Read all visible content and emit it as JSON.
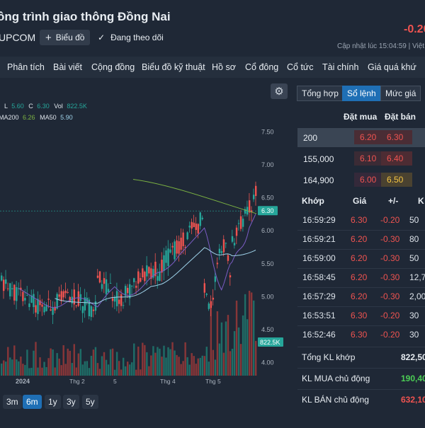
{
  "header": {
    "title": "ông trình giao thông Đồng Nai",
    "exchange": "UPCOM",
    "chart_button": "Biểu đồ",
    "follow_label": "Đang theo dõi",
    "change": "-0.20",
    "updated": "Cập nhật lúc  15:04:59 | Việt"
  },
  "nav": [
    "Phân tích",
    "Bài viết",
    "Cộng đồng",
    "Biểu đồ kỹ thuật",
    "Hồ sơ",
    "Cổ đông",
    "Cổ tức",
    "Tài chính",
    "Giá quá khứ"
  ],
  "legend": {
    "ohlc": [
      {
        "label": "L",
        "value": "5.60"
      },
      {
        "label": "C",
        "value": "6.30"
      },
      {
        "label": "Vol",
        "value": "822.5K"
      }
    ],
    "ma": [
      {
        "label": "MA200",
        "value": "6.26"
      },
      {
        "label": "MA50",
        "value": "5.90"
      }
    ]
  },
  "colors": {
    "up": "#26a69a",
    "down": "#ef5350",
    "ma200": "#7cb342",
    "ma50": "#9fd3ea",
    "ma20": "#7b5cc4",
    "accent": "#1f6fb5"
  },
  "chart_data": {
    "type": "candlestick",
    "y_ticks": [
      "7.50",
      "7.00",
      "6.50",
      "6.00",
      "5.50",
      "5.00",
      "4.50",
      "4.00"
    ],
    "ylim": [
      3.9,
      7.6
    ],
    "x_ticks": [
      "2024",
      "Thg 2",
      "5",
      "Thg 4",
      "Thg 5"
    ],
    "last_price_label": "6.30",
    "last_volume_label": "822.5K",
    "last_price": 6.3
  },
  "range_buttons": [
    "3m",
    "6m",
    "1y",
    "3y",
    "5y"
  ],
  "range_active": "6m",
  "right_panel": {
    "tabs": [
      "Tổng hợp",
      "Sổ lệnh",
      "Mức giá"
    ],
    "active_tab": "Sổ lệnh",
    "orderbook_headers": {
      "bid": "Đặt mua",
      "ask": "Đặt bán"
    },
    "orderbook": [
      {
        "vol": "200",
        "bid": "6.20",
        "ask": "6.30"
      },
      {
        "vol": "155,000",
        "bid": "6.10",
        "ask": "6.40"
      },
      {
        "vol": "164,900",
        "bid": "6.00",
        "ask": "6.50"
      }
    ],
    "trades_headers": {
      "time": "Khớp",
      "price": "Giá",
      "change": "+/-",
      "vol": "K"
    },
    "trades": [
      {
        "time": "16:59:29",
        "price": "6.30",
        "change": "-0.20",
        "vol": "50"
      },
      {
        "time": "16:59:21",
        "price": "6.20",
        "change": "-0.30",
        "vol": "80"
      },
      {
        "time": "16:59:00",
        "price": "6.20",
        "change": "-0.30",
        "vol": "50"
      },
      {
        "time": "16:58:45",
        "price": "6.20",
        "change": "-0.30",
        "vol": "12,70"
      },
      {
        "time": "16:57:29",
        "price": "6.20",
        "change": "-0.30",
        "vol": "2,00"
      },
      {
        "time": "16:53:51",
        "price": "6.30",
        "change": "-0.20",
        "vol": "30"
      },
      {
        "time": "16:52:46",
        "price": "6.30",
        "change": "-0.20",
        "vol": "30"
      }
    ],
    "summary": [
      {
        "label": "Tổng KL khớp",
        "value": "822,50"
      },
      {
        "label": "KL MUA chủ động",
        "value": "190,40"
      },
      {
        "label": "KL BÁN chủ động",
        "value": "632,10"
      }
    ]
  }
}
